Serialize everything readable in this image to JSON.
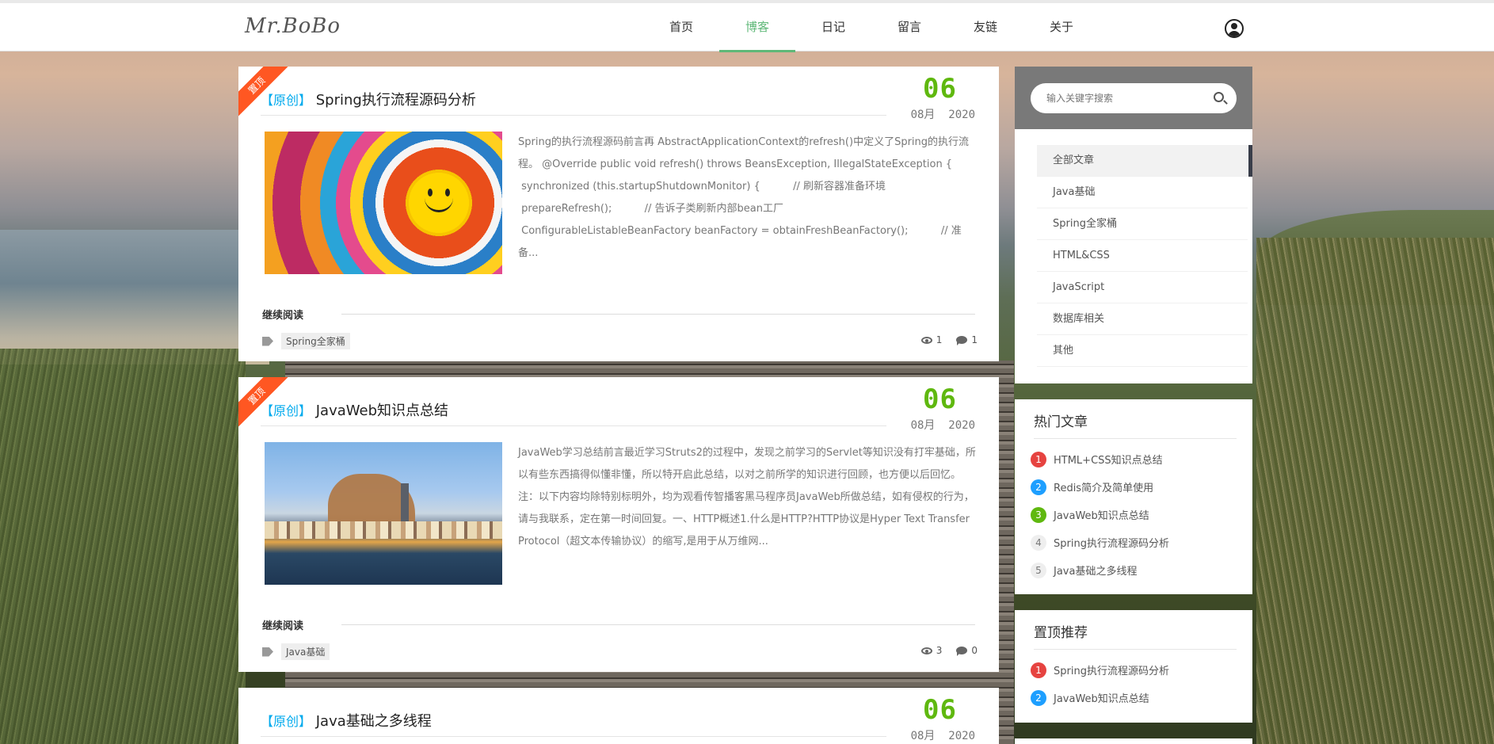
{
  "header": {
    "logo": "Mr.BoBo",
    "nav": [
      "首页",
      "博客",
      "日记",
      "留言",
      "友链",
      "关于"
    ],
    "active_nav": "博客"
  },
  "posts": [
    {
      "ribbon": "置顶",
      "tag": "【原创】",
      "title": "Spring执行流程源码分析",
      "day": "06",
      "month_year": "08月  2020",
      "excerpt": "Spring的执行流程源码前言再 AbstractApplicationContext的refresh()中定义了Spring的执行流程。 @Override public void refresh() throws BeansException, IllegalStateException {\n synchronized (this.startupShutdownMonitor) {          // 刷新容器准备环境\n prepareRefresh();          // 告诉子类刷新内部bean工厂\n ConfigurableListableBeanFactory beanFactory = obtainFreshBeanFactory();          // 准备...",
      "read_more": "继续阅读",
      "category_tag": "Spring全家桶",
      "views": "1",
      "comments": "1"
    },
    {
      "ribbon": "置顶",
      "tag": "【原创】",
      "title": "JavaWeb知识点总结",
      "day": "06",
      "month_year": "08月  2020",
      "excerpt": "JavaWeb学习总结前言最近学习Struts2的过程中，发现之前学习的Servlet等知识没有打牢基础，所以有些东西搞得似懂非懂，所以特开启此总结，以对之前所学的知识进行回顾，也方便以后回忆。注：以下内容均除特别标明外，均为观看传智播客黑马程序员JavaWeb所做总结，如有侵权的行为，请与我联系，定在第一时间回复。一、HTTP概述1.什么是HTTP?HTTP协议是Hyper Text Transfer Protocol（超文本传输协议）的缩写,是用于从万维网...",
      "read_more": "继续阅读",
      "category_tag": "Java基础",
      "views": "3",
      "comments": "0"
    },
    {
      "tag": "【原创】",
      "title": "Java基础之多线程",
      "day": "06",
      "month_year": "08月  2020"
    }
  ],
  "sidebar": {
    "search_placeholder": "输入关键字搜索",
    "categories": [
      "全部文章",
      "Java基础",
      "Spring全家桶",
      "HTML&CSS",
      "JavaScript",
      "数据库相关",
      "其他"
    ],
    "hot_title": "热门文章",
    "hot": [
      {
        "num": "1",
        "title": "HTML+CSS知识点总结"
      },
      {
        "num": "2",
        "title": "Redis简介及简单使用"
      },
      {
        "num": "3",
        "title": "JavaWeb知识点总结"
      },
      {
        "num": "4",
        "title": "Spring执行流程源码分析"
      },
      {
        "num": "5",
        "title": "Java基础之多线程"
      }
    ],
    "top_title": "置顶推荐",
    "top": [
      {
        "num": "1",
        "title": "Spring执行流程源码分析"
      },
      {
        "num": "2",
        "title": "JavaWeb知识点总结"
      }
    ]
  },
  "colors": {
    "accent": "#5fb878",
    "date": "#5fb80f",
    "ribbon": "#ff5722",
    "tag_blue": "#01aaed"
  }
}
